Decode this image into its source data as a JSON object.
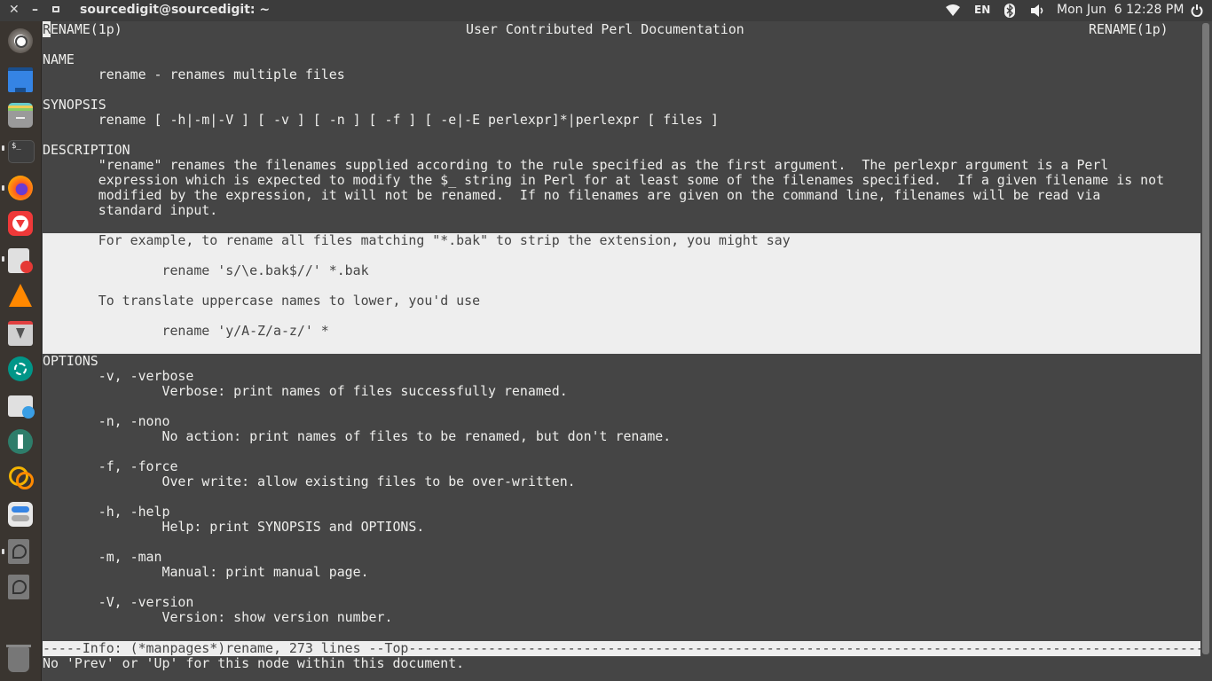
{
  "window": {
    "title": "sourcedigit@sourcedigit: ~",
    "controls": {
      "close": "✕",
      "minimize": "–",
      "maximize": "▫"
    }
  },
  "tray": {
    "keyboard_layout": "EN",
    "clock": "Mon Jun  6 12:28 PM",
    "icons": [
      "wifi-icon",
      "bluetooth-icon",
      "volume-icon",
      "power-icon"
    ]
  },
  "launcher": {
    "items": [
      {
        "name": "ubuntu-dash",
        "color": "#cccccc"
      },
      {
        "name": "files-desktop",
        "color": "#3584e4"
      },
      {
        "name": "file-cabinet",
        "color": "#8a8a8a"
      },
      {
        "name": "terminal",
        "color": "#3a3a3a"
      },
      {
        "name": "firefox",
        "color": "#ff7139"
      },
      {
        "name": "vivaldi",
        "color": "#ef3939"
      },
      {
        "name": "text-editor",
        "color": "#e0e0e0"
      },
      {
        "name": "vlc",
        "color": "#ff8800"
      },
      {
        "name": "installer",
        "color": "#d0d0d0"
      },
      {
        "name": "shutter",
        "color": "#009688"
      },
      {
        "name": "software-updater",
        "color": "#e0e0e0"
      },
      {
        "name": "settings-tool",
        "color": "#2e7d6a"
      },
      {
        "name": "app-link",
        "color": "#f4b400"
      },
      {
        "name": "tweaks",
        "color": "#e8e8e8"
      },
      {
        "name": "drive-1",
        "color": "#7a7a7a"
      },
      {
        "name": "drive-2",
        "color": "#7a7a7a"
      },
      {
        "name": "trash",
        "color": "#777777"
      }
    ]
  },
  "man": {
    "header_left_cursor": "R",
    "header_left_rest": "ENAME(1p)",
    "header_center": "User Contributed Perl Documentation",
    "header_right": "RENAME(1p)",
    "name_heading": "NAME",
    "name_text": "       rename - renames multiple files",
    "synopsis_heading": "SYNOPSIS",
    "synopsis_text": "       rename [ -h|-m|-V ] [ -v ] [ -n ] [ -f ] [ -e|-E perlexpr]*|perlexpr [ files ]",
    "description_heading": "DESCRIPTION",
    "description_lines": [
      "       \"rename\" renames the filenames supplied according to the rule specified as the first argument.  The perlexpr argument is a Perl",
      "       expression which is expected to modify the $_ string in Perl for at least some of the filenames specified.  If a given filename is not",
      "       modified by the expression, it will not be renamed.  If no filenames are given on the command line, filenames will be read via",
      "       standard input."
    ],
    "example_lines": [
      "       For example, to rename all files matching \"*.bak\" to strip the extension, you might say",
      "",
      "               rename 's/\\e.bak$//' *.bak",
      "",
      "       To translate uppercase names to lower, you'd use",
      "",
      "               rename 'y/A-Z/a-z/' *"
    ],
    "options_heading": "OPTIONS",
    "options": [
      {
        "flag": "       -v, -verbose",
        "desc": "               Verbose: print names of files successfully renamed."
      },
      {
        "flag": "       -n, -nono",
        "desc": "               No action: print names of files to be renamed, but don't rename."
      },
      {
        "flag": "       -f, -force",
        "desc": "               Over write: allow existing files to be over-written."
      },
      {
        "flag": "       -h, -help",
        "desc": "               Help: print SYNOPSIS and OPTIONS."
      },
      {
        "flag": "       -m, -man",
        "desc": "               Manual: print manual page."
      },
      {
        "flag": "       -V, -version",
        "desc": "               Version: show version number."
      }
    ]
  },
  "status": {
    "modeline": "-----Info: (*manpages*)rename, 273 lines --Top----------------------------------------------------------------------------------------------------------------------------------",
    "echo_area": "No 'Prev' or 'Up' for this node within this document."
  },
  "colors": {
    "terminal_bg": "#454545",
    "terminal_fg": "#eeeeec",
    "highlight_bg": "#eeeeee"
  }
}
